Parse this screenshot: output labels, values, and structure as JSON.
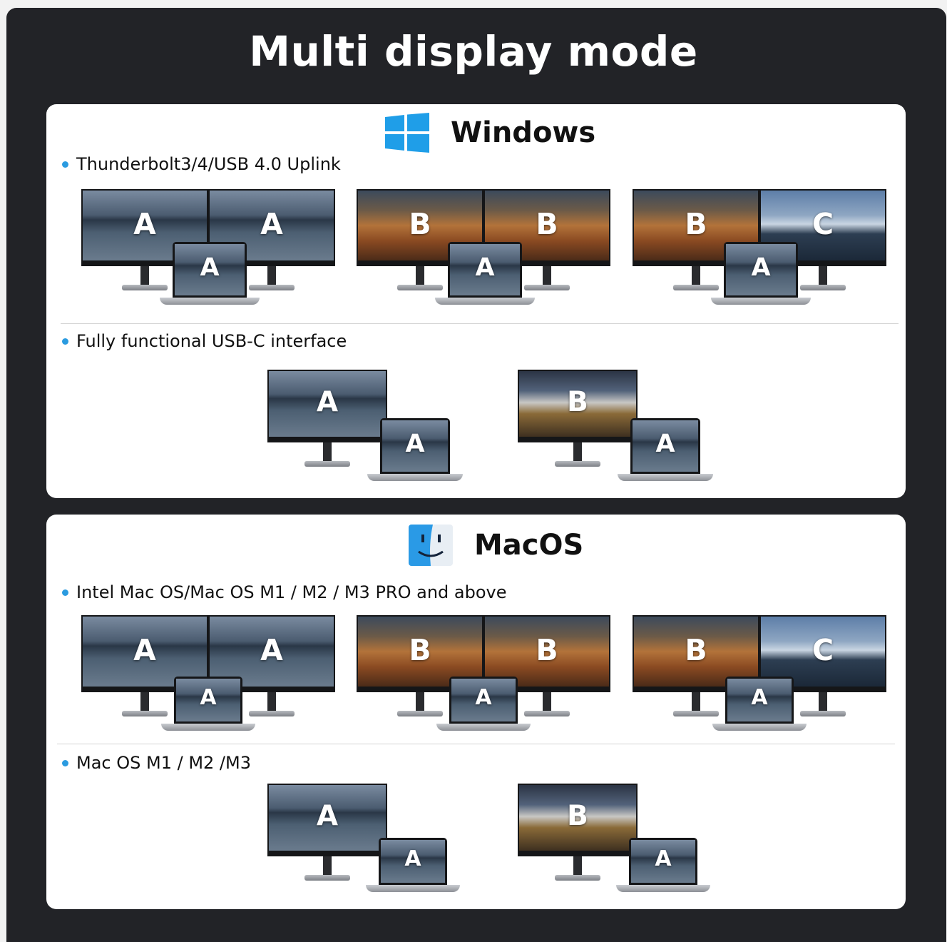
{
  "title": "Multi display mode",
  "windows": {
    "label": "Windows",
    "icon": "windows-logo-icon",
    "sections": [
      {
        "label": "Thunderbolt3/4/USB 4.0 Uplink"
      },
      {
        "label": "Fully functional USB-C interface"
      }
    ]
  },
  "macos": {
    "label": "MacOS",
    "icon": "finder-logo-icon",
    "sections": [
      {
        "label": "Intel Mac OS/Mac OS M1 / M2 / M3 PRO and above"
      },
      {
        "label": "Mac OS M1 / M2 /M3"
      }
    ]
  },
  "letters": {
    "a": "A",
    "b": "B",
    "c": "C"
  },
  "colors": {
    "background": "#222327",
    "panel": "#ffffff",
    "bullet": "#2b9be0",
    "windows_blue": "#1f9ee8"
  }
}
